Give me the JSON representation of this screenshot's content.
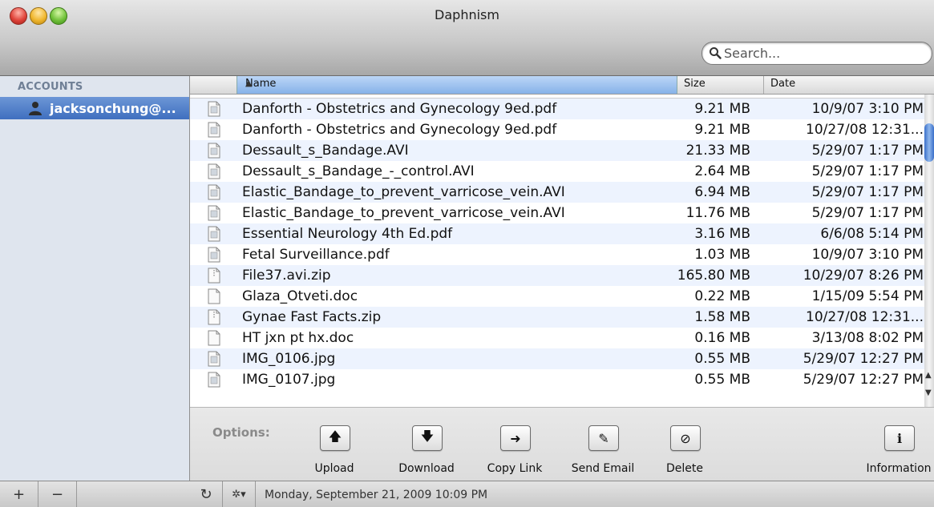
{
  "window": {
    "title": "Daphnism"
  },
  "search": {
    "placeholder": "Search..."
  },
  "sidebar": {
    "header": "ACCOUNTS",
    "accounts": [
      {
        "label": "jacksonchung@..."
      }
    ]
  },
  "table": {
    "columns": {
      "name": "Name",
      "size": "Size",
      "date": "Date"
    },
    "rows": [
      {
        "name": "Danforth - Obstetrics and Gynecology 9ed.pdf",
        "size": "9.21 MB",
        "date": "10/9/07 3:10 PM",
        "icon": "pdf-icon"
      },
      {
        "name": "Danforth - Obstetrics and Gynecology 9ed.pdf",
        "size": "9.21 MB",
        "date": "10/27/08 12:31...",
        "icon": "pdf-icon"
      },
      {
        "name": "Dessault_s_Bandage.AVI",
        "size": "21.33 MB",
        "date": "5/29/07 1:17 PM",
        "icon": "video-icon"
      },
      {
        "name": "Dessault_s_Bandage_-_control.AVI",
        "size": "2.64 MB",
        "date": "5/29/07 1:17 PM",
        "icon": "video-icon"
      },
      {
        "name": "Elastic_Bandage_to_prevent_varricose_vein.AVI",
        "size": "6.94 MB",
        "date": "5/29/07 1:17 PM",
        "icon": "video-icon"
      },
      {
        "name": "Elastic_Bandage_to_prevent_varricose_vein.AVI",
        "size": "11.76 MB",
        "date": "5/29/07 1:17 PM",
        "icon": "video-icon"
      },
      {
        "name": "Essential Neurology 4th Ed.pdf",
        "size": "3.16 MB",
        "date": "6/6/08 5:14 PM",
        "icon": "pdf-icon"
      },
      {
        "name": "Fetal Surveillance.pdf",
        "size": "1.03 MB",
        "date": "10/9/07 3:10 PM",
        "icon": "pdf-icon"
      },
      {
        "name": "File37.avi.zip",
        "size": "165.80 MB",
        "date": "10/29/07 8:26 PM",
        "icon": "zip-icon"
      },
      {
        "name": "Glaza_Otveti.doc",
        "size": "0.22 MB",
        "date": "1/15/09 5:54 PM",
        "icon": "document-icon"
      },
      {
        "name": "Gynae Fast Facts.zip",
        "size": "1.58 MB",
        "date": "10/27/08 12:31...",
        "icon": "zip-icon"
      },
      {
        "name": "HT jxn pt hx.doc",
        "size": "0.16 MB",
        "date": "3/13/08 8:02 PM",
        "icon": "document-icon"
      },
      {
        "name": "IMG_0106.jpg",
        "size": "0.55 MB",
        "date": "5/29/07 12:27 PM",
        "icon": "image-icon"
      },
      {
        "name": "IMG_0107.jpg",
        "size": "0.55 MB",
        "date": "5/29/07 12:27 PM",
        "icon": "image-icon"
      }
    ]
  },
  "options": {
    "label": "Options:",
    "buttons": [
      {
        "label": "Upload",
        "glyph": "🡅",
        "icon": "upload-arrow-icon"
      },
      {
        "label": "Download",
        "glyph": "🡇",
        "icon": "download-arrow-icon"
      },
      {
        "label": "Copy Link",
        "glyph": "➜",
        "icon": "copy-link-arrow-icon"
      },
      {
        "label": "Send Email",
        "glyph": "✎",
        "icon": "compose-icon"
      },
      {
        "label": "Delete",
        "glyph": "⊘",
        "icon": "prohibited-icon"
      },
      {
        "label": "Information",
        "glyph": "i",
        "icon": "info-icon"
      }
    ]
  },
  "bottombar": {
    "add": "+",
    "remove": "−",
    "refresh": "↻",
    "action": "✲▾",
    "status": "Monday, September 21, 2009 10:09 PM"
  },
  "colors": {
    "selection": "#3f6fbf",
    "header_sorted": "#86b2e8",
    "row_alt": "#edf3fe"
  }
}
